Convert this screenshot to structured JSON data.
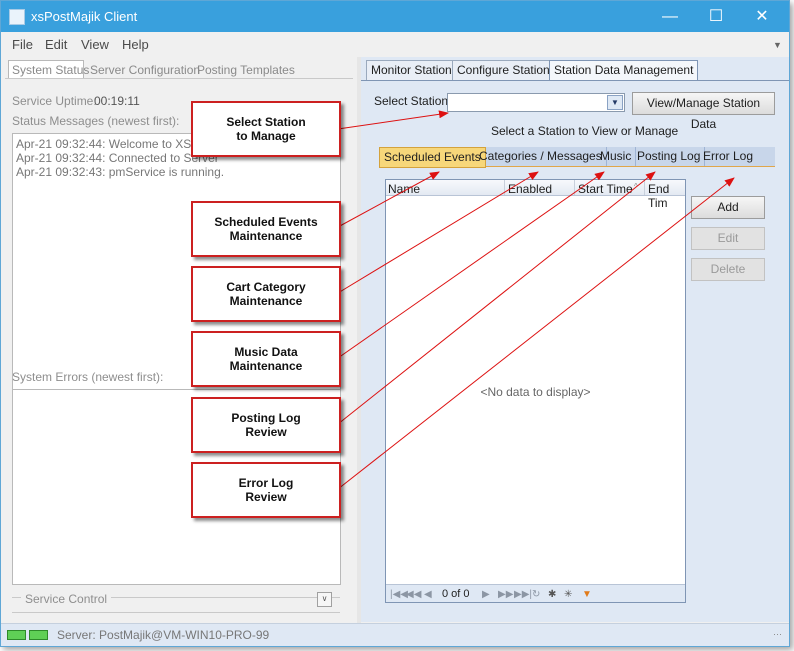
{
  "window": {
    "title": "xsPostMajik Client"
  },
  "menu": {
    "file": "File",
    "edit": "Edit",
    "view": "View",
    "help": "Help"
  },
  "left": {
    "tabs": [
      "System Status",
      "Server Configuration",
      "Posting Templates"
    ],
    "uptime_label": "Service Uptime:",
    "uptime_value": "00:19:11",
    "messages_label": "Status Messages (newest first):",
    "messages": [
      "Apr-21 09:32:44: Welcome to XStudio",
      "Apr-21 09:32:44: Connected to Server",
      "Apr-21 09:32:43: pmService is running."
    ],
    "errors_label": "System Errors (newest first):",
    "service_control_label": "Service Control"
  },
  "right": {
    "tabs": [
      "Monitor Station",
      "Configure Stations",
      "Station Data Management"
    ],
    "select_station_label": "Select Station",
    "select_station_value": "",
    "view_manage_button": "View/Manage Station Data",
    "hint": "Select a Station to View or Manage",
    "inner_tabs": [
      "Scheduled Events",
      "Categories / Messages",
      "Music",
      "Posting Log",
      "Error Log"
    ],
    "grid_columns": [
      "Name",
      "Enabled",
      "Start Time",
      "End Tim"
    ],
    "empty_text": "<No data to display>",
    "buttons": {
      "add": "Add",
      "edit": "Edit",
      "delete": "Delete"
    },
    "pager": {
      "text": "0 of 0"
    }
  },
  "status": {
    "server": "Server: PostMajik@VM-WIN10-PRO-99"
  },
  "callouts": [
    "Select Station\nto Manage",
    "Scheduled Events\nMaintenance",
    "Cart Category\nMaintenance",
    "Music Data\nMaintenance",
    "Posting Log\nReview",
    "Error Log\nReview"
  ],
  "colors": {
    "titlebar": "#39a0dd",
    "callout_border": "#cc2020",
    "active_tab": "#f7d77a"
  }
}
